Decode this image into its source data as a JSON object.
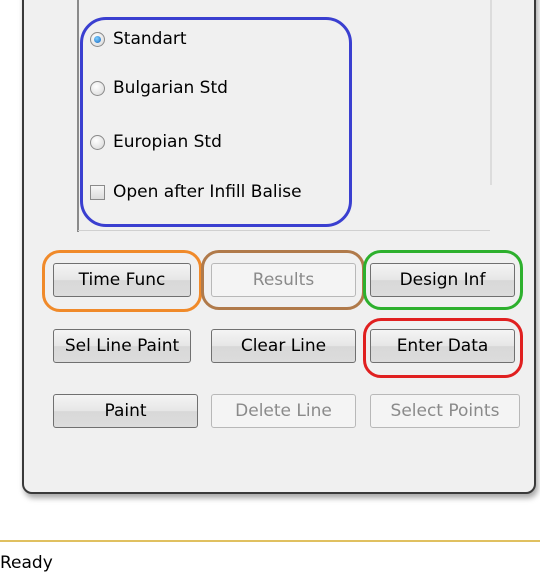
{
  "options": {
    "standart": "Standart",
    "bulgarian": "Bulgarian Std",
    "europian": "Europian Std",
    "open_after": "Open after Infill Balise",
    "selected": "Standart"
  },
  "buttons": {
    "time_func": "Time Func",
    "results": "Results",
    "design_inf": "Design Inf",
    "sel_line_paint": "Sel Line Paint",
    "clear_line": "Clear Line",
    "enter_data": "Enter Data",
    "paint": "Paint",
    "delete_line": "Delete Line",
    "select_points": "Select Points"
  },
  "annotation_colors": {
    "options": "#3a3fd0",
    "time_func": "#f08a2a",
    "results": "#b07a4a",
    "design_inf": "#2db02d",
    "enter_data": "#e02020"
  },
  "status": {
    "text": "Ready"
  }
}
